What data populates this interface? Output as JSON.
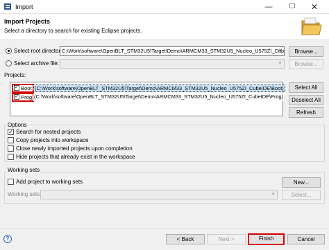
{
  "window": {
    "title": "Import",
    "minimize": "—",
    "maximize": "☐",
    "close": "✕"
  },
  "header": {
    "title": "Import Projects",
    "description": "Select a directory to search for existing Eclipse projects."
  },
  "source": {
    "root_label": "Select root directory:",
    "root_value": "C:\\Work\\software\\OpenBLT_STM32U5\\Target\\Demo\\ARMCM33_STM32U5_Nucleo_U575ZI_CubeIDE",
    "root_selected": true,
    "archive_label": "Select archive file:",
    "archive_value": "",
    "browse_label": "Browse...",
    "browse2_label": "Browse..."
  },
  "projects": {
    "label": "Projects:",
    "items": [
      {
        "name": "Boot",
        "path": "(C:\\Work\\software\\OpenBLT_STM32U5\\Target\\Demo\\ARMCM33_STM32U5_Nucleo_U575ZI_CubeIDE\\Boot)",
        "checked": true
      },
      {
        "name": "Prog",
        "path": "(C:\\Work\\software\\OpenBLT_STM32U5\\Target\\Demo\\ARMCM33_STM32U5_Nucleo_U575ZI_CubeIDE\\Prog)",
        "checked": true
      }
    ],
    "select_all": "Select All",
    "deselect_all": "Deselect All",
    "refresh": "Refresh"
  },
  "options": {
    "title": "Options",
    "items": [
      {
        "label": "Search for nested projects",
        "checked": true
      },
      {
        "label": "Copy projects into workspace",
        "checked": false
      },
      {
        "label": "Close newly imported projects upon completion",
        "checked": false
      },
      {
        "label": "Hide projects that already exist in the workspace",
        "checked": false
      }
    ]
  },
  "working_sets": {
    "title": "Working sets",
    "add_label": "Add project to working sets",
    "add_checked": false,
    "new_label": "New...",
    "sets_label": "Working sets:",
    "select_label": "Select..."
  },
  "footer": {
    "help_icon": "?",
    "back": "< Back",
    "next": "Next >",
    "finish": "Finish",
    "cancel": "Cancel"
  },
  "colors": {
    "highlight": "#cce4f7",
    "annotation_red": "#d40000"
  }
}
